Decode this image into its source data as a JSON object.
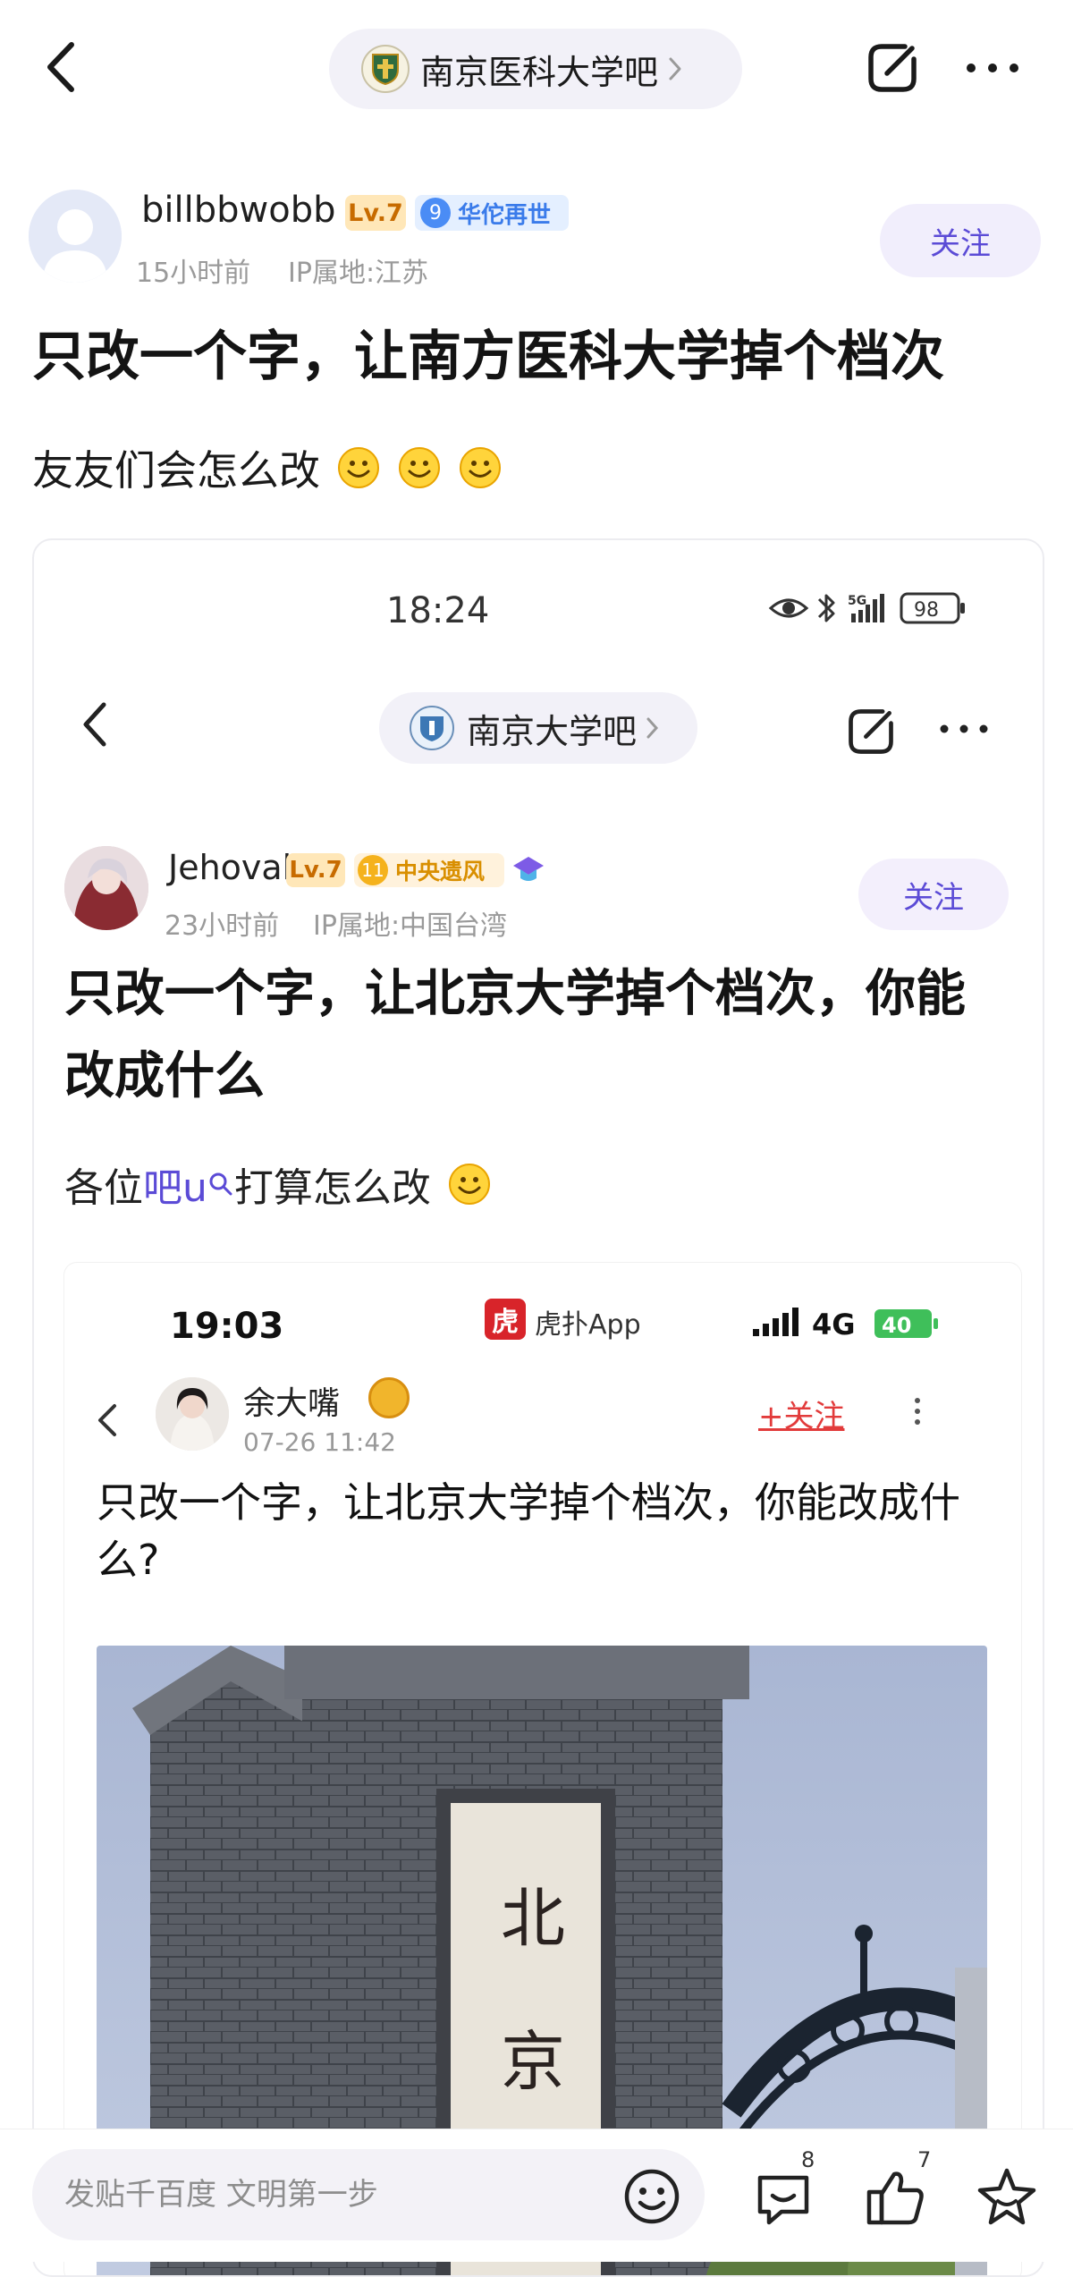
{
  "nav": {
    "forum_name": "南京医科大学吧"
  },
  "post": {
    "author": {
      "username": "billbbwobb",
      "level": "Lv.7",
      "medal_level": "9",
      "medal_name": "华佗再世",
      "time_ago": "15小时前",
      "ip_location": "IP属地:江苏"
    },
    "follow_label": "关注",
    "title": "只改一个字，让南方医科大学掉个档次",
    "body": "友友们会怎么改"
  },
  "embedded": {
    "status_time": "18:24",
    "battery": "98",
    "signal": "5G",
    "forum_name": "南京大学吧",
    "author": {
      "username": "Jehovah",
      "level": "Lv.7",
      "medal_level": "11",
      "medal_name": "中央遗风",
      "time_ago": "23小时前",
      "ip_location": "IP属地:中国台湾"
    },
    "follow_label": "关注",
    "title": "只改一个字，让北京大学掉个档次，你能改成什么",
    "body_prefix": "各位",
    "body_link": "吧u",
    "body_suffix": "打算怎么改",
    "nested": {
      "status_time": "19:03",
      "app_name": "虎扑App",
      "app_logo_char": "虎",
      "network": "4G",
      "battery": "40",
      "author": "余大嘴",
      "date": "07-26 11:42",
      "follow_label": "+关注",
      "title": "只改一个字，让北京大学掉个档次，你能改成什么?",
      "gate_chars": [
        "北",
        "京"
      ]
    }
  },
  "bottom_bar": {
    "reply_placeholder": "发贴千百度 文明第一步",
    "comment_count": "8",
    "like_count": "7"
  },
  "colors": {
    "accent_purple": "#5b4bd6",
    "follow_bg": "#f1eefc",
    "level_bg": "#ffe7b8",
    "level_text": "#c76b00",
    "medal_blue": "#3a7bea",
    "medal_gold": "#d98f00",
    "hupu_red": "#d8242a",
    "follow_red": "#e23b3b"
  },
  "icons": {
    "nav_back": "chevron-left-icon",
    "forum_chevron": "chevron-right-icon",
    "edit": "edit-share-icon",
    "more": "more-horizontal-icon",
    "emoji": "smile-emoji-icon",
    "comment": "comment-icon",
    "like": "thumbs-up-icon",
    "favorite": "star-icon"
  }
}
